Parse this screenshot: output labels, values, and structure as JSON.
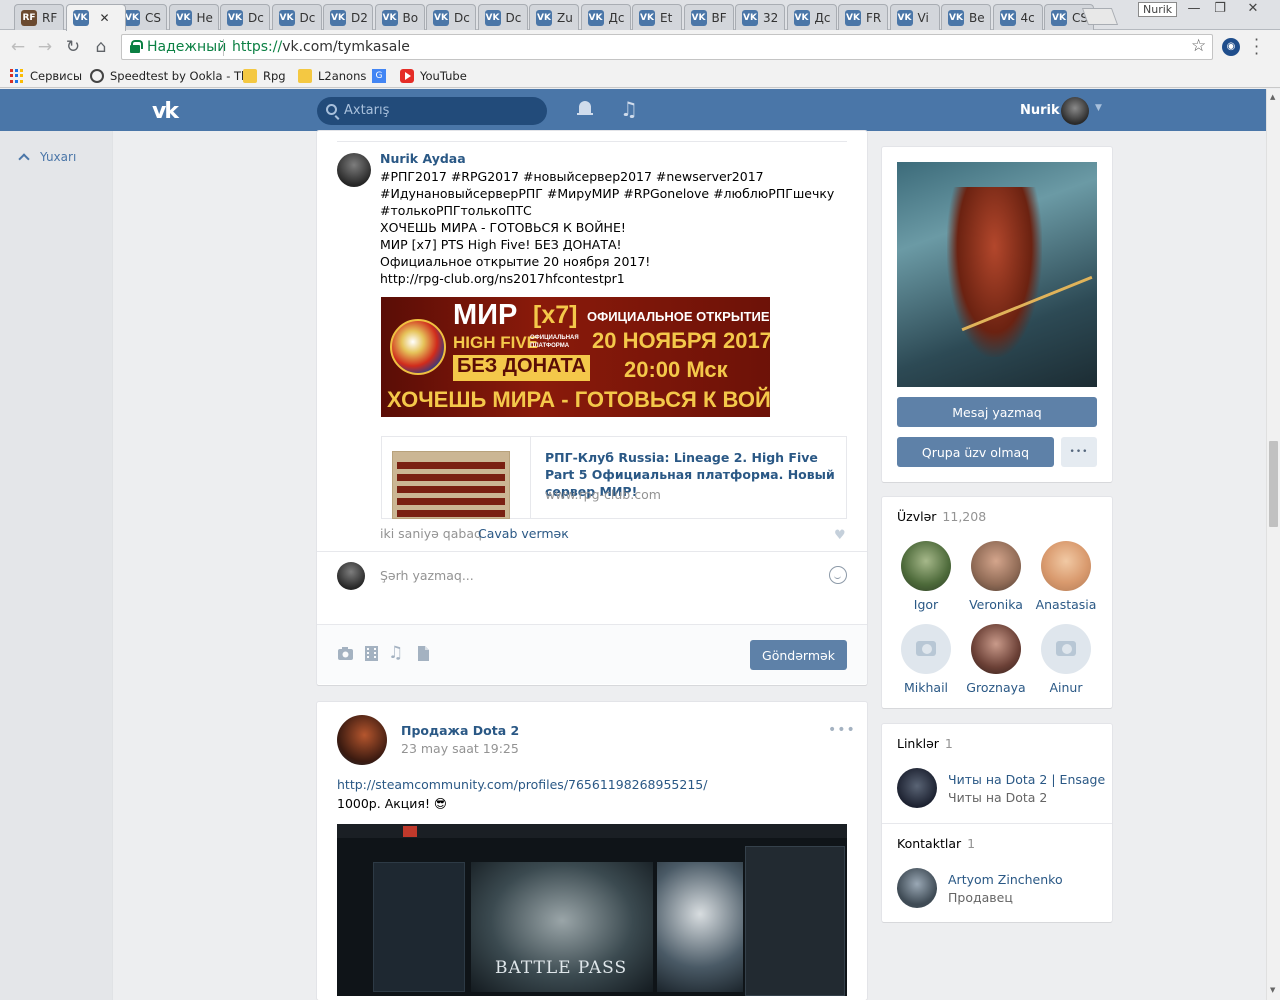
{
  "browser": {
    "tabs": [
      {
        "icon": "RF",
        "label": "RF"
      },
      {
        "icon": "VK",
        "label": "",
        "close": "✕"
      },
      {
        "icon": "VK",
        "label": "CS"
      },
      {
        "icon": "VK",
        "label": "He"
      },
      {
        "icon": "VK",
        "label": "Dc"
      },
      {
        "icon": "VK",
        "label": "Dc"
      },
      {
        "icon": "VK",
        "label": "D2"
      },
      {
        "icon": "VK",
        "label": "Bo"
      },
      {
        "icon": "VK",
        "label": "Dc"
      },
      {
        "icon": "VK",
        "label": "Dc"
      },
      {
        "icon": "VK",
        "label": "Zu"
      },
      {
        "icon": "VK",
        "label": "Дс"
      },
      {
        "icon": "VK",
        "label": "Et"
      },
      {
        "icon": "VK",
        "label": "BF"
      },
      {
        "icon": "VK",
        "label": "32"
      },
      {
        "icon": "VK",
        "label": "Дс"
      },
      {
        "icon": "VK",
        "label": "FR"
      },
      {
        "icon": "VK",
        "label": "Vi"
      },
      {
        "icon": "VK",
        "label": "Be"
      },
      {
        "icon": "VK",
        "label": "4c"
      },
      {
        "icon": "VK",
        "label": "CS"
      }
    ],
    "profile_name": "Nurik",
    "window_controls": [
      "—",
      "❐",
      "✕"
    ],
    "secure_label": "Надежный",
    "url_protocol": "https://",
    "url_rest": "vk.com/tymkasale",
    "bookmarks": [
      {
        "icon": "apps-icon",
        "label": "Сервисы"
      },
      {
        "icon": "speedometer-icon",
        "label": "Speedtest by Ookla - Th"
      },
      {
        "icon": "folder-icon",
        "label": "Rpg"
      },
      {
        "icon": "folder-icon",
        "label": "L2anons"
      },
      {
        "icon": "translate-icon",
        "label": ""
      },
      {
        "icon": "youtube-icon",
        "label": "YouTube"
      }
    ]
  },
  "vk": {
    "logo": "vk",
    "search_placeholder": "Axtarış",
    "user_name": "Nurik",
    "to_top": "Yuxarı"
  },
  "comment": {
    "author": "Nurik Aydaa",
    "lines": [
      "#РПГ2017 #RPG2017 #новыйсервер2017 #newserver2017",
      "#ИдунановыйсерверРПГ #МируМИР #RPGonelove #люблюРПГшечку",
      "#толькоРПГтолькоПТС",
      "ХОЧЕШЬ МИРА - ГОТОВЬСЯ К ВОЙНЕ!",
      "МИР [x7] PTS High Five! БЕЗ ДОНАТА!",
      "Официальное открытие 20 ноября 2017!"
    ],
    "link": "http://rpg-club.org/ns2017hfcontestpr1",
    "banner": {
      "mir": "МИР",
      "x7": "[x7]",
      "official_opening": "ОФИЦИАЛЬНОЕ ОТКРЫТИЕ",
      "high_five": "HIGH FIVE",
      "platform": "ОФИЦИАЛЬНАЯ ПЛАТФОРМА",
      "date": "20 НОЯБРЯ 2017",
      "no_donate": "БЕЗ ДОНАТА",
      "time": "20:00 Мск",
      "slogan": "ХОЧЕШЬ МИРА - ГОТОВЬСЯ К ВОЙНЕ"
    },
    "link_card": {
      "title": "РПГ-Клуб Russia: Lineage 2. High Five Part 5 Официальная платформа. Новый сервер МИР!",
      "domain": "www.rpg-club.com"
    },
    "time": "iki saniyə qabaq",
    "reply": "Cavab verməк"
  },
  "composer": {
    "placeholder": "Şərh yazmaq...",
    "send_label": "Göndərmək"
  },
  "post2": {
    "author": "Продажа Dota 2",
    "date": "23 may saat 19:25",
    "link": "http://steamcommunity.com/profiles/76561198268955215/",
    "text": "1000р. Акция! 😎",
    "image_caption": "BATTLE PASS"
  },
  "sidebar": {
    "message_button": "Mesaj yazmaq",
    "leave_group_button": "Qrupa üzv olmaq",
    "more_button": "•••",
    "members_title": "Üzvlər",
    "members_count": "11,208",
    "members": [
      {
        "name": "Igor",
        "photo": "photo"
      },
      {
        "name": "Veronika",
        "photo": "photo"
      },
      {
        "name": "Anastasia",
        "photo": "photo"
      },
      {
        "name": "Mikhail",
        "photo": "camera-placeholder-icon"
      },
      {
        "name": "Groznaya",
        "photo": "photo"
      },
      {
        "name": "Ainur",
        "photo": "camera-placeholder-icon"
      }
    ],
    "links_title": "Linklər",
    "links_count": "1",
    "link_item": {
      "title": "Читы на Dota 2 | Ensage",
      "subtitle": "Читы на Dota 2"
    },
    "contacts_title": "Kontaktlar",
    "contacts_count": "1",
    "contact": {
      "name": "Artyom Zinchenko",
      "role": "Продавец"
    }
  },
  "colors": {
    "vk_blue": "#4a76a8",
    "link": "#2a5885",
    "secure_green": "#0b8043"
  }
}
